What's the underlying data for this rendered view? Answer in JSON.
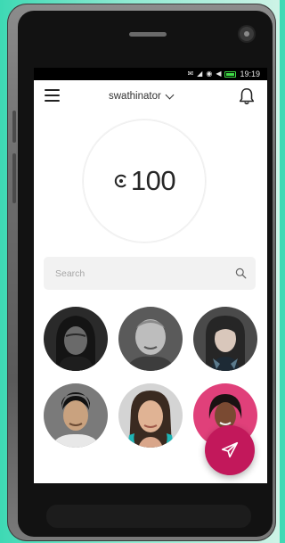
{
  "status_bar": {
    "time": "19:19"
  },
  "header": {
    "menu_icon": "hamburger-icon",
    "account_name": "swathinator",
    "notification_icon": "bell-icon"
  },
  "balance": {
    "currency_icon": "coin-icon",
    "amount": "100"
  },
  "search": {
    "placeholder": "Search",
    "value": ""
  },
  "contacts": {
    "count_visible": 6
  },
  "actions": {
    "send_icon": "send-icon",
    "accent_color": "#c2185b"
  }
}
